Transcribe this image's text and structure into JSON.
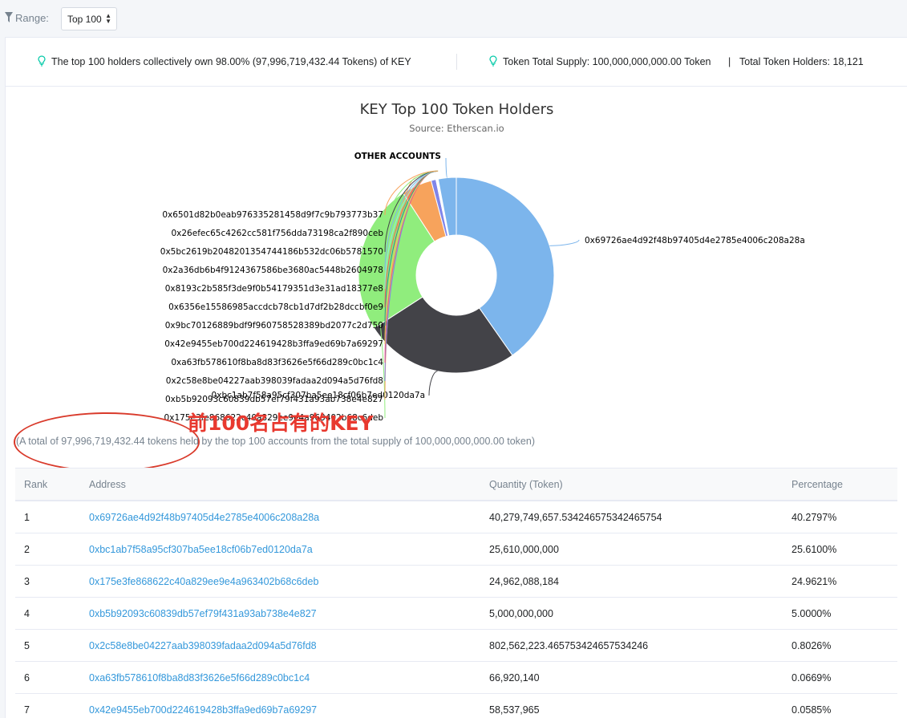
{
  "range": {
    "label": "Range:",
    "selected": "Top 100"
  },
  "summary": {
    "left_text": "The top 100 holders collectively own 98.00% (97,996,719,432.44 Tokens) of KEY",
    "supply_text": "Token Total Supply: 100,000,000,000.00 Token",
    "separator": "|",
    "holders_text": "Total Token Holders: 18,121"
  },
  "chart_data": {
    "type": "pie",
    "title": "KEY Top 100 Token Holders",
    "subtitle": "Source: Etherscan.io",
    "slices": [
      {
        "name": "0x69726ae4d92f48b97405d4e2785e4006c208a28a",
        "value": 40.2797,
        "color": "#7cb5ec"
      },
      {
        "name": "0xbc1ab7f58a95cf307ba5ee18cf06b7ed0120da7a",
        "value": 25.61,
        "color": "#434348"
      },
      {
        "name": "0x175e3fe868622c40a829ee9e4a963402b68c6deb",
        "value": 24.9621,
        "color": "#90ed7d"
      },
      {
        "name": "0xb5b92093c60839db57ef79f431a93ab738e4e827",
        "value": 5.0,
        "color": "#f7a35c"
      },
      {
        "name": "0x2c58e8be04227aab398039fadaa2d094a5d76fd8",
        "value": 0.8026,
        "color": "#8085e9"
      },
      {
        "name": "0xa63fb578610f8ba8d83f3626e5f66d289c0bc1c4",
        "value": 0.0669,
        "color": "#f15c80"
      },
      {
        "name": "0x42e9455eb700d224619428b3ffa9ed69b7a69297",
        "value": 0.0585,
        "color": "#e4d354"
      },
      {
        "name": "0x9bc70126889bdf9f960758528389bd2077c2d750",
        "value": 0.05,
        "color": "#2b908f"
      },
      {
        "name": "0x6356e15586985accdcb78cb1d7df2b28dccbf0e9",
        "value": 0.045,
        "color": "#f45b5b"
      },
      {
        "name": "0x8193c2b585f3de9f0b54179351d3e31ad18377e8",
        "value": 0.04,
        "color": "#91e8e1"
      },
      {
        "name": "0x2a36db6b4f9124367586be3680ac5448b2604978",
        "value": 0.035,
        "color": "#7cb5ec"
      },
      {
        "name": "0x5bc2619b2048201354744186b532dc06b5781570",
        "value": 0.03,
        "color": "#434348"
      },
      {
        "name": "0x26efec65c4262cc581f756dda73198ca2f890ceb",
        "value": 0.025,
        "color": "#90ed7d"
      },
      {
        "name": "0x6501d82b0eab976335281458d9f7c9b793773b37",
        "value": 0.02,
        "color": "#f7a35c"
      },
      {
        "name": "OTHER ACCOUNTS",
        "value": 2.9752,
        "color": "#7cb5ec"
      }
    ]
  },
  "annotation": "前100名占有的KEY",
  "total_note": "(A total of 97,996,719,432.44 tokens held by the top 100 accounts from the total supply of 100,000,000,000.00 token)",
  "table": {
    "headers": {
      "rank": "Rank",
      "address": "Address",
      "quantity": "Quantity (Token)",
      "percentage": "Percentage"
    },
    "rows": [
      {
        "rank": "1",
        "address": "0x69726ae4d92f48b97405d4e2785e4006c208a28a",
        "quantity": "40,279,749,657.534246575342465754",
        "percentage": "40.2797%"
      },
      {
        "rank": "2",
        "address": "0xbc1ab7f58a95cf307ba5ee18cf06b7ed0120da7a",
        "quantity": "25,610,000,000",
        "percentage": "25.6100%"
      },
      {
        "rank": "3",
        "address": "0x175e3fe868622c40a829ee9e4a963402b68c6deb",
        "quantity": "24,962,088,184",
        "percentage": "24.9621%"
      },
      {
        "rank": "4",
        "address": "0xb5b92093c60839db57ef79f431a93ab738e4e827",
        "quantity": "5,000,000,000",
        "percentage": "5.0000%"
      },
      {
        "rank": "5",
        "address": "0x2c58e8be04227aab398039fadaa2d094a5d76fd8",
        "quantity": "802,562,223.465753424657534246",
        "percentage": "0.8026%"
      },
      {
        "rank": "6",
        "address": "0xa63fb578610f8ba8d83f3626e5f66d289c0bc1c4",
        "quantity": "66,920,140",
        "percentage": "0.0669%"
      },
      {
        "rank": "7",
        "address": "0x42e9455eb700d224619428b3ffa9ed69b7a69297",
        "quantity": "58,537,965",
        "percentage": "0.0585%"
      }
    ]
  }
}
